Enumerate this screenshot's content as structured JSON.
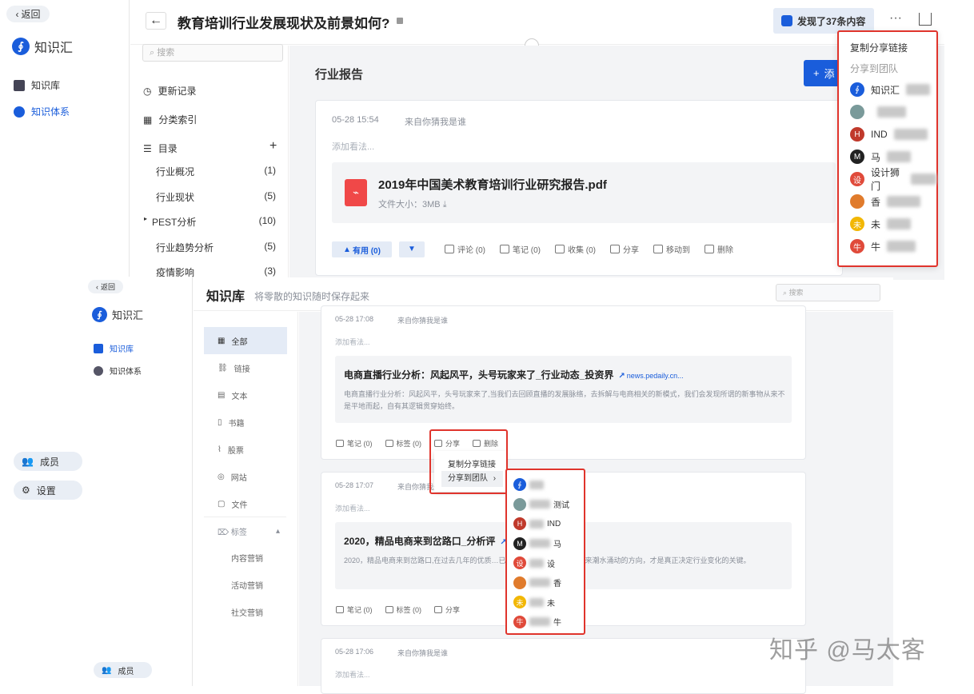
{
  "top": {
    "back": "返回",
    "brand": "知识汇",
    "nav": [
      {
        "label": "知识库",
        "icon": "library-icon"
      },
      {
        "label": "知识体系",
        "icon": "knowledge-system-icon"
      }
    ],
    "title": "教育培训行业发展现状及前景如何?",
    "found": "发现了37条内容",
    "search_placeholder": "搜索",
    "side_links": [
      "更新记录",
      "分类索引",
      "目录"
    ],
    "catalog": [
      {
        "label": "行业概况",
        "count": "(1)"
      },
      {
        "label": "行业现状",
        "count": "(5)"
      },
      {
        "label": "PEST分析",
        "count": "(10)"
      },
      {
        "label": "行业趋势分析",
        "count": "(5)"
      },
      {
        "label": "疫情影响",
        "count": "(3)"
      }
    ],
    "section": "行业报告",
    "add_btn": "添",
    "card": {
      "time": "05-28 15:54",
      "source": "来自你猜我是谁",
      "placeholder": "添加看法...",
      "file": "2019年中国美术教育培训行业研究报告.pdf",
      "size": "文件大小：3MB"
    },
    "actions": {
      "useful": "有用 (0)",
      "comment": "评论 (0)",
      "note": "笔记 (0)",
      "collect": "收集 (0)",
      "share": "分享",
      "move": "移动到",
      "delete": "删除"
    },
    "share_menu": {
      "copy": "复制分享链接",
      "team": "分享到团队",
      "teams": [
        "知识汇",
        "",
        "IND",
        "马",
        "设计狮门",
        "香",
        "未",
        "牛"
      ]
    }
  },
  "bottom": {
    "back": "返回",
    "brand": "知识汇",
    "nav": [
      {
        "label": "知识库",
        "icon": "library-icon"
      },
      {
        "label": "知识体系",
        "icon": "knowledge-system-icon"
      }
    ],
    "members": "成员",
    "header_title": "知识库",
    "header_sub": "将零散的知识随时保存起来",
    "search_placeholder": "搜索",
    "filters": [
      "全部",
      "链接",
      "文本",
      "书籍",
      "股票",
      "网站",
      "文件"
    ],
    "tags_label": "标签",
    "tags": [
      "内容营销",
      "活动营销",
      "社交营销"
    ],
    "cards": [
      {
        "time": "05-28 17:08",
        "source": "来自你猜我是谁",
        "placeholder": "添加看法...",
        "title": "电商直播行业分析：风起风平，头号玩家来了_行业动态_投资界",
        "url": "news.pedaily.cn...",
        "desc": "电商直播行业分析：风起风平，头号玩家来了,当我们去回顾直播的发展脉络，去拆解与电商相关的新模式，我们会发现所谓的新事物从来不是平地而起，自有其逻辑贯穿始终。"
      },
      {
        "time": "05-28 17:07",
        "source": "来自你猜我是谁",
        "placeholder": "添加看法...",
        "title": "2020，精品电商来到岔路口_分析评",
        "url": "news.pedaily.cn...",
        "desc": "2020，精品电商来到岔路口,在过去几年的优质…已经退烧却没有退潮，接下来潮水涌动的方向，才是真正决定行业变化的关键。"
      },
      {
        "time": "05-28 17:06",
        "source": "来自你猜我是谁",
        "placeholder": "添加看法..."
      }
    ],
    "card_actions": {
      "note": "笔记 (0)",
      "tag": "标签 (0)",
      "share": "分享",
      "delete": "删除"
    },
    "popup": {
      "copy": "复制分享链接",
      "team": "分享到团队"
    },
    "teams": [
      "",
      "测试",
      "IND",
      "马",
      "设",
      "香",
      "未",
      "牛"
    ]
  },
  "left_pills": {
    "members": "成员",
    "settings": "设置"
  },
  "watermark": "知乎 @马太客"
}
